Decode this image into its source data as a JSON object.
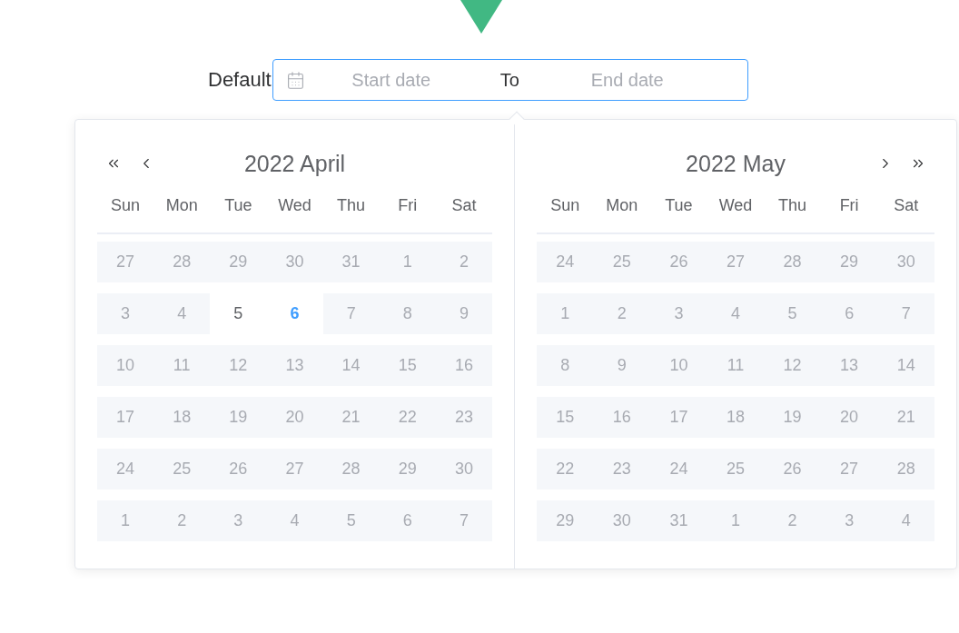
{
  "date_range": {
    "label": "Default",
    "focused": true,
    "start": {
      "placeholder": "Start date"
    },
    "separator": "To",
    "end": {
      "placeholder": "End date"
    }
  },
  "calendar": {
    "panels": [
      {
        "title": "2022 April",
        "weekdays": [
          "Sun",
          "Mon",
          "Tue",
          "Wed",
          "Thu",
          "Fri",
          "Sat"
        ],
        "weeks": [
          [
            {
              "label": "27",
              "disabled": true,
              "today": false
            },
            {
              "label": "28",
              "disabled": true,
              "today": false
            },
            {
              "label": "29",
              "disabled": true,
              "today": false
            },
            {
              "label": "30",
              "disabled": true,
              "today": false
            },
            {
              "label": "31",
              "disabled": true,
              "today": false
            },
            {
              "label": "1",
              "disabled": true,
              "today": false
            },
            {
              "label": "2",
              "disabled": true,
              "today": false
            }
          ],
          [
            {
              "label": "3",
              "disabled": true,
              "today": false
            },
            {
              "label": "4",
              "disabled": true,
              "today": false
            },
            {
              "label": "5",
              "disabled": false,
              "today": false
            },
            {
              "label": "6",
              "disabled": false,
              "today": true
            },
            {
              "label": "7",
              "disabled": true,
              "today": false
            },
            {
              "label": "8",
              "disabled": true,
              "today": false
            },
            {
              "label": "9",
              "disabled": true,
              "today": false
            }
          ],
          [
            {
              "label": "10",
              "disabled": true,
              "today": false
            },
            {
              "label": "11",
              "disabled": true,
              "today": false
            },
            {
              "label": "12",
              "disabled": true,
              "today": false
            },
            {
              "label": "13",
              "disabled": true,
              "today": false
            },
            {
              "label": "14",
              "disabled": true,
              "today": false
            },
            {
              "label": "15",
              "disabled": true,
              "today": false
            },
            {
              "label": "16",
              "disabled": true,
              "today": false
            }
          ],
          [
            {
              "label": "17",
              "disabled": true,
              "today": false
            },
            {
              "label": "18",
              "disabled": true,
              "today": false
            },
            {
              "label": "19",
              "disabled": true,
              "today": false
            },
            {
              "label": "20",
              "disabled": true,
              "today": false
            },
            {
              "label": "21",
              "disabled": true,
              "today": false
            },
            {
              "label": "22",
              "disabled": true,
              "today": false
            },
            {
              "label": "23",
              "disabled": true,
              "today": false
            }
          ],
          [
            {
              "label": "24",
              "disabled": true,
              "today": false
            },
            {
              "label": "25",
              "disabled": true,
              "today": false
            },
            {
              "label": "26",
              "disabled": true,
              "today": false
            },
            {
              "label": "27",
              "disabled": true,
              "today": false
            },
            {
              "label": "28",
              "disabled": true,
              "today": false
            },
            {
              "label": "29",
              "disabled": true,
              "today": false
            },
            {
              "label": "30",
              "disabled": true,
              "today": false
            }
          ],
          [
            {
              "label": "1",
              "disabled": true,
              "today": false
            },
            {
              "label": "2",
              "disabled": true,
              "today": false
            },
            {
              "label": "3",
              "disabled": true,
              "today": false
            },
            {
              "label": "4",
              "disabled": true,
              "today": false
            },
            {
              "label": "5",
              "disabled": true,
              "today": false
            },
            {
              "label": "6",
              "disabled": true,
              "today": false
            },
            {
              "label": "7",
              "disabled": true,
              "today": false
            }
          ]
        ]
      },
      {
        "title": "2022 May",
        "weekdays": [
          "Sun",
          "Mon",
          "Tue",
          "Wed",
          "Thu",
          "Fri",
          "Sat"
        ],
        "weeks": [
          [
            {
              "label": "24",
              "disabled": true,
              "today": false
            },
            {
              "label": "25",
              "disabled": true,
              "today": false
            },
            {
              "label": "26",
              "disabled": true,
              "today": false
            },
            {
              "label": "27",
              "disabled": true,
              "today": false
            },
            {
              "label": "28",
              "disabled": true,
              "today": false
            },
            {
              "label": "29",
              "disabled": true,
              "today": false
            },
            {
              "label": "30",
              "disabled": true,
              "today": false
            }
          ],
          [
            {
              "label": "1",
              "disabled": true,
              "today": false
            },
            {
              "label": "2",
              "disabled": true,
              "today": false
            },
            {
              "label": "3",
              "disabled": true,
              "today": false
            },
            {
              "label": "4",
              "disabled": true,
              "today": false
            },
            {
              "label": "5",
              "disabled": true,
              "today": false
            },
            {
              "label": "6",
              "disabled": true,
              "today": false
            },
            {
              "label": "7",
              "disabled": true,
              "today": false
            }
          ],
          [
            {
              "label": "8",
              "disabled": true,
              "today": false
            },
            {
              "label": "9",
              "disabled": true,
              "today": false
            },
            {
              "label": "10",
              "disabled": true,
              "today": false
            },
            {
              "label": "11",
              "disabled": true,
              "today": false
            },
            {
              "label": "12",
              "disabled": true,
              "today": false
            },
            {
              "label": "13",
              "disabled": true,
              "today": false
            },
            {
              "label": "14",
              "disabled": true,
              "today": false
            }
          ],
          [
            {
              "label": "15",
              "disabled": true,
              "today": false
            },
            {
              "label": "16",
              "disabled": true,
              "today": false
            },
            {
              "label": "17",
              "disabled": true,
              "today": false
            },
            {
              "label": "18",
              "disabled": true,
              "today": false
            },
            {
              "label": "19",
              "disabled": true,
              "today": false
            },
            {
              "label": "20",
              "disabled": true,
              "today": false
            },
            {
              "label": "21",
              "disabled": true,
              "today": false
            }
          ],
          [
            {
              "label": "22",
              "disabled": true,
              "today": false
            },
            {
              "label": "23",
              "disabled": true,
              "today": false
            },
            {
              "label": "24",
              "disabled": true,
              "today": false
            },
            {
              "label": "25",
              "disabled": true,
              "today": false
            },
            {
              "label": "26",
              "disabled": true,
              "today": false
            },
            {
              "label": "27",
              "disabled": true,
              "today": false
            },
            {
              "label": "28",
              "disabled": true,
              "today": false
            }
          ],
          [
            {
              "label": "29",
              "disabled": true,
              "today": false
            },
            {
              "label": "30",
              "disabled": true,
              "today": false
            },
            {
              "label": "31",
              "disabled": true,
              "today": false
            },
            {
              "label": "1",
              "disabled": true,
              "today": false
            },
            {
              "label": "2",
              "disabled": true,
              "today": false
            },
            {
              "label": "3",
              "disabled": true,
              "today": false
            },
            {
              "label": "4",
              "disabled": true,
              "today": false
            }
          ]
        ]
      }
    ]
  }
}
